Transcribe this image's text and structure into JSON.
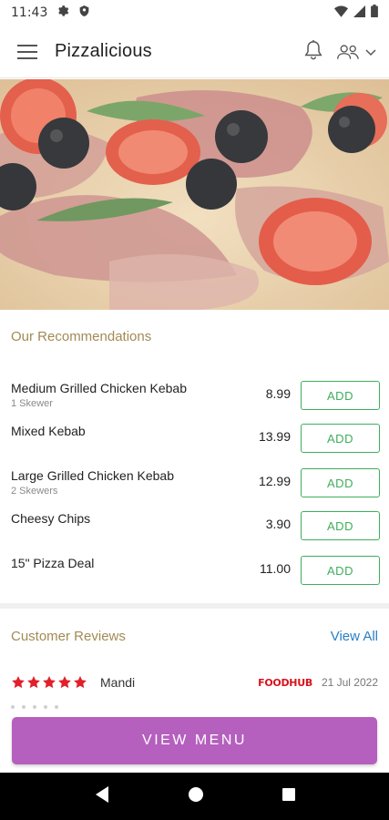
{
  "status_bar": {
    "time": "11:43"
  },
  "app_bar": {
    "title": "Pizzalicious"
  },
  "recommendations": {
    "title": "Our Recommendations",
    "items": [
      {
        "name": "Medium Grilled Chicken Kebab",
        "sub": "1 Skewer",
        "price": "8.99",
        "button": "ADD"
      },
      {
        "name": "Mixed Kebab",
        "sub": "",
        "price": "13.99",
        "button": "ADD"
      },
      {
        "name": "Large Grilled Chicken Kebab",
        "sub": "2 Skewers",
        "price": "12.99",
        "button": "ADD"
      },
      {
        "name": "Cheesy Chips",
        "sub": "",
        "price": "3.90",
        "button": "ADD"
      },
      {
        "name": "15\" Pizza Deal",
        "sub": "",
        "price": "11.00",
        "button": "ADD"
      }
    ]
  },
  "reviews": {
    "title": "Customer Reviews",
    "view_all": "View All",
    "items": [
      {
        "reviewer": "Mandi",
        "rating": 5,
        "source": "FOODHUB",
        "date": "21 Jul 2022"
      }
    ]
  },
  "cta": {
    "label": "VIEW MENU"
  },
  "colors": {
    "accent_green": "#3fae5b",
    "cta_purple": "#b55fbe",
    "section_title": "#a28a55",
    "link_blue": "#2a7fc3",
    "star_red": "#e0202a"
  },
  "icons": {
    "status": [
      "settings-icon",
      "shield-icon",
      "wifi-icon",
      "signal-icon",
      "battery-icon"
    ],
    "app_bar": [
      "hamburger-menu-icon",
      "bell-icon",
      "group-users-icon",
      "chevron-down-icon"
    ],
    "nav": [
      "back-icon",
      "home-icon",
      "recents-icon"
    ]
  }
}
